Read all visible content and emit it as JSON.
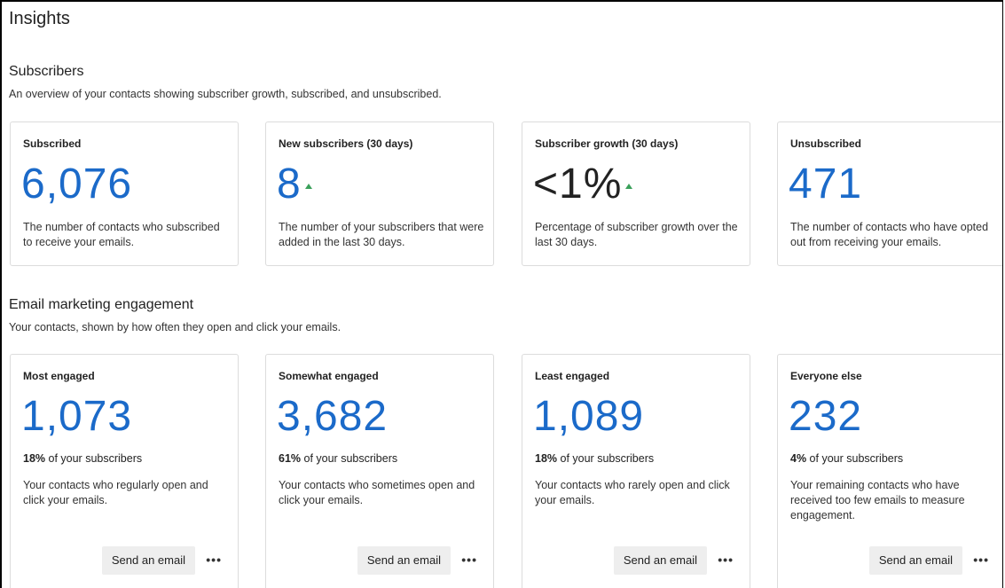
{
  "page": {
    "title": "Insights"
  },
  "subscribers": {
    "title": "Subscribers",
    "description": "An overview of your contacts showing subscriber growth, subscribed, and unsubscribed.",
    "cards": [
      {
        "label": "Subscribed",
        "value": "6,076",
        "trend": "",
        "description": "The number of contacts who subscribed to receive your emails."
      },
      {
        "label": "New subscribers (30 days)",
        "value": "8",
        "trend": "up",
        "description": "The number of your subscribers that were added in the last 30 days."
      },
      {
        "label": "Subscriber growth (30 days)",
        "value": "<1%",
        "trend": "up",
        "description": "Percentage of subscriber growth over the last 30 days."
      },
      {
        "label": "Unsubscribed",
        "value": "471",
        "trend": "",
        "description": "The number of contacts who have opted out from receiving your emails."
      }
    ]
  },
  "engagement": {
    "title": "Email marketing engagement",
    "description": "Your contacts, shown by how often they open and click your emails.",
    "cards": [
      {
        "label": "Most engaged",
        "value": "1,073",
        "percent": "18%",
        "percent_suffix": " of your subscribers",
        "description": "Your contacts who regularly open and click your emails.",
        "button_label": "Send an email",
        "more_label": "•••"
      },
      {
        "label": "Somewhat engaged",
        "value": "3,682",
        "percent": "61%",
        "percent_suffix": " of your subscribers",
        "description": "Your contacts who sometimes open and click your emails.",
        "button_label": "Send an email",
        "more_label": "•••"
      },
      {
        "label": "Least engaged",
        "value": "1,089",
        "percent": "18%",
        "percent_suffix": " of your subscribers",
        "description": "Your contacts who rarely open and click your emails.",
        "button_label": "Send an email",
        "more_label": "•••"
      },
      {
        "label": "Everyone else",
        "value": "232",
        "percent": "4%",
        "percent_suffix": " of your subscribers",
        "description": "Your remaining contacts who have received too few emails to measure engagement.",
        "button_label": "Send an email",
        "more_label": "•••"
      }
    ]
  },
  "colors": {
    "accent": "#1b6ac9",
    "trend_up": "#3aa05a",
    "card_border": "#dcdcdc",
    "button_bg": "#eeeeee"
  },
  "icons": {
    "trend": "up-arrow-icon",
    "more": "more-horizontal-icon"
  }
}
